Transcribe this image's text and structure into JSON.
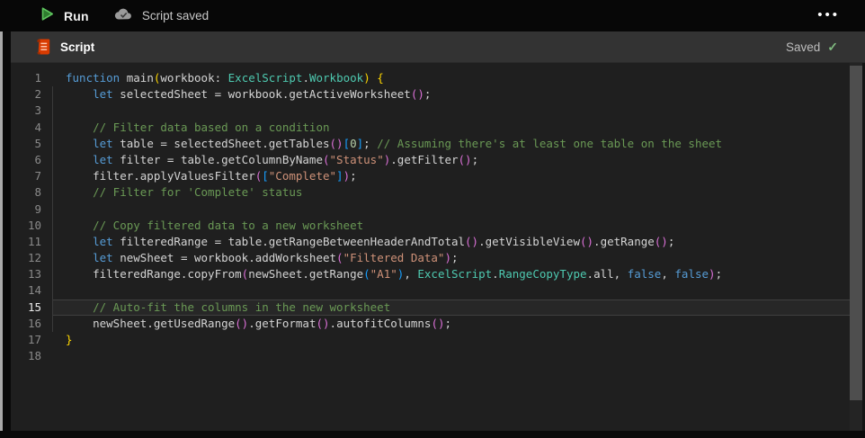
{
  "toolbar": {
    "run_label": "Run",
    "saved_status": "Script saved",
    "more_label": "•••"
  },
  "header": {
    "title": "Script",
    "saved_label": "Saved",
    "saved_check": "✓"
  },
  "colors": {
    "kw": "#569cd6",
    "type": "#4ec9b0",
    "str": "#ce9178",
    "com": "#6a9955",
    "num": "#b5cea8",
    "fg": "#d4d4d4",
    "p1": "#ffd700",
    "p2": "#da70d6",
    "p3": "#179fff",
    "run_icon_green": "#4caf50",
    "script_icon_orange": "#d83b01",
    "saved_check_green": "#7fb97f"
  },
  "editor": {
    "active_line": 15,
    "lines": [
      {
        "n": 1,
        "tokens": [
          [
            "kw",
            "function"
          ],
          [
            "fg",
            " main"
          ],
          [
            "p1",
            "("
          ],
          [
            "fg",
            "workbook: "
          ],
          [
            "type",
            "ExcelScript"
          ],
          [
            "fg",
            "."
          ],
          [
            "type",
            "Workbook"
          ],
          [
            "p1",
            ")"
          ],
          [
            "fg",
            " "
          ],
          [
            "p1",
            "{"
          ]
        ]
      },
      {
        "n": 2,
        "tokens": [
          [
            "fg",
            "    "
          ],
          [
            "kw",
            "let"
          ],
          [
            "fg",
            " selectedSheet = workbook.getActiveWorksheet"
          ],
          [
            "p2",
            "()"
          ],
          [
            "fg",
            ";"
          ]
        ]
      },
      {
        "n": 3,
        "tokens": []
      },
      {
        "n": 4,
        "tokens": [
          [
            "fg",
            "    "
          ],
          [
            "com",
            "// Filter data based on a condition"
          ]
        ]
      },
      {
        "n": 5,
        "tokens": [
          [
            "fg",
            "    "
          ],
          [
            "kw",
            "let"
          ],
          [
            "fg",
            " table = selectedSheet.getTables"
          ],
          [
            "p2",
            "()"
          ],
          [
            "p3",
            "["
          ],
          [
            "num",
            "0"
          ],
          [
            "p3",
            "]"
          ],
          [
            "fg",
            "; "
          ],
          [
            "com",
            "// Assuming there's at least one table on the sheet"
          ]
        ]
      },
      {
        "n": 6,
        "tokens": [
          [
            "fg",
            "    "
          ],
          [
            "kw",
            "let"
          ],
          [
            "fg",
            " filter = table.getColumnByName"
          ],
          [
            "p2",
            "("
          ],
          [
            "str",
            "\"Status\""
          ],
          [
            "p2",
            ")"
          ],
          [
            "fg",
            ".getFilter"
          ],
          [
            "p2",
            "()"
          ],
          [
            "fg",
            ";"
          ]
        ]
      },
      {
        "n": 7,
        "tokens": [
          [
            "fg",
            "    filter.applyValuesFilter"
          ],
          [
            "p2",
            "("
          ],
          [
            "p3",
            "["
          ],
          [
            "str",
            "\"Complete\""
          ],
          [
            "p3",
            "]"
          ],
          [
            "p2",
            ")"
          ],
          [
            "fg",
            ";"
          ]
        ]
      },
      {
        "n": 8,
        "tokens": [
          [
            "fg",
            "    "
          ],
          [
            "com",
            "// Filter for 'Complete' status"
          ]
        ]
      },
      {
        "n": 9,
        "tokens": []
      },
      {
        "n": 10,
        "tokens": [
          [
            "fg",
            "    "
          ],
          [
            "com",
            "// Copy filtered data to a new worksheet"
          ]
        ]
      },
      {
        "n": 11,
        "tokens": [
          [
            "fg",
            "    "
          ],
          [
            "kw",
            "let"
          ],
          [
            "fg",
            " filteredRange = table.getRangeBetweenHeaderAndTotal"
          ],
          [
            "p2",
            "()"
          ],
          [
            "fg",
            ".getVisibleView"
          ],
          [
            "p2",
            "()"
          ],
          [
            "fg",
            ".getRange"
          ],
          [
            "p2",
            "()"
          ],
          [
            "fg",
            ";"
          ]
        ]
      },
      {
        "n": 12,
        "tokens": [
          [
            "fg",
            "    "
          ],
          [
            "kw",
            "let"
          ],
          [
            "fg",
            " newSheet = workbook.addWorksheet"
          ],
          [
            "p2",
            "("
          ],
          [
            "str",
            "\"Filtered Data\""
          ],
          [
            "p2",
            ")"
          ],
          [
            "fg",
            ";"
          ]
        ]
      },
      {
        "n": 13,
        "tokens": [
          [
            "fg",
            "    filteredRange.copyFrom"
          ],
          [
            "p2",
            "("
          ],
          [
            "fg",
            "newSheet.getRange"
          ],
          [
            "p3",
            "("
          ],
          [
            "str",
            "\"A1\""
          ],
          [
            "p3",
            ")"
          ],
          [
            "fg",
            ", "
          ],
          [
            "type",
            "ExcelScript"
          ],
          [
            "fg",
            "."
          ],
          [
            "type",
            "RangeCopyType"
          ],
          [
            "fg",
            ".all, "
          ],
          [
            "kw",
            "false"
          ],
          [
            "fg",
            ", "
          ],
          [
            "kw",
            "false"
          ],
          [
            "p2",
            ")"
          ],
          [
            "fg",
            ";"
          ]
        ]
      },
      {
        "n": 14,
        "tokens": []
      },
      {
        "n": 15,
        "tokens": [
          [
            "fg",
            "    "
          ],
          [
            "com",
            "// Auto-fit the columns in the new worksheet"
          ]
        ]
      },
      {
        "n": 16,
        "tokens": [
          [
            "fg",
            "    newSheet.getUsedRange"
          ],
          [
            "p2",
            "()"
          ],
          [
            "fg",
            ".getFormat"
          ],
          [
            "p2",
            "()"
          ],
          [
            "fg",
            ".autofitColumns"
          ],
          [
            "p2",
            "()"
          ],
          [
            "fg",
            ";"
          ]
        ]
      },
      {
        "n": 17,
        "tokens": [
          [
            "p1",
            "}"
          ]
        ]
      },
      {
        "n": 18,
        "tokens": []
      }
    ]
  }
}
